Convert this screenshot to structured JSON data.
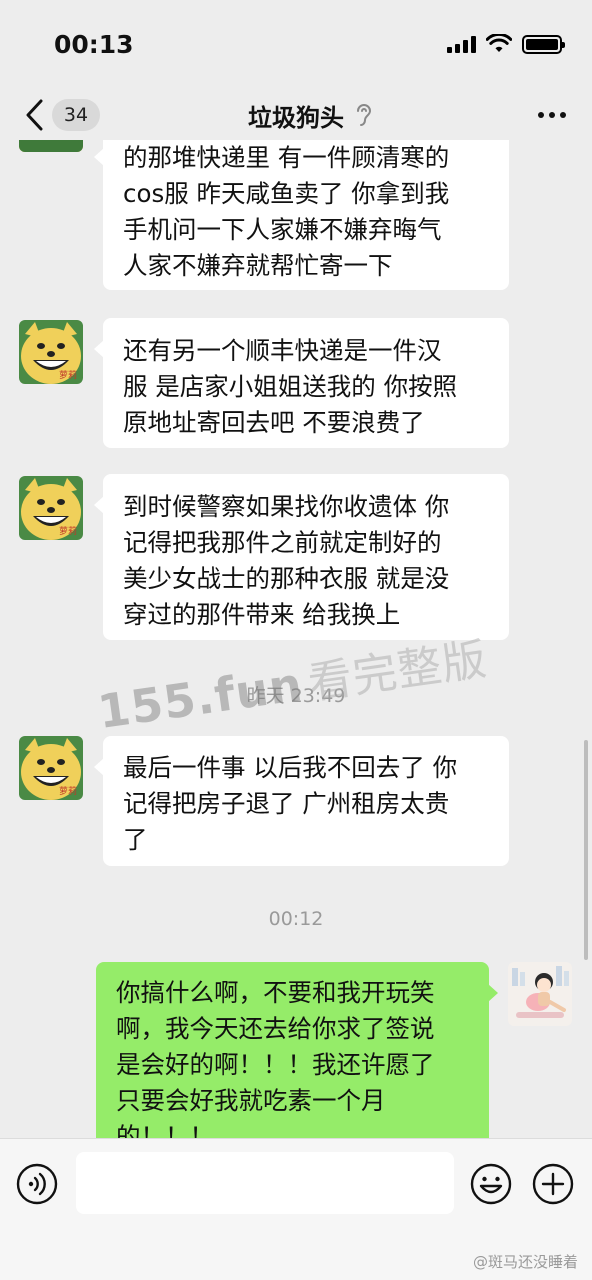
{
  "status_bar": {
    "time": "00:13"
  },
  "nav": {
    "unread_count": "34",
    "title": "垃圾狗头"
  },
  "chat": {
    "messages": [
      {
        "lines": [
          "的那堆快递里 有一件顾清寒的",
          "cos服 昨天咸鱼卖了 你拿到我",
          "手机问一下人家嫌不嫌弃晦气",
          "人家不嫌弃就帮忙寄一下"
        ]
      },
      {
        "lines": [
          "还有另一个顺丰快递是一件汉",
          "服 是店家小姐姐送我的 你按照",
          "原地址寄回去吧 不要浪费了"
        ]
      },
      {
        "lines": [
          "到时候警察如果找你收遗体 你",
          "记得把我那件之前就定制好的",
          "美少女战士的那种衣服 就是没",
          "穿过的那件带来 给我换上"
        ]
      },
      {
        "lines": [
          "最后一件事 以后我不回去了 你",
          "记得把房子退了 广州租房太贵",
          "了"
        ]
      },
      {
        "lines": [
          "你搞什么啊，不要和我开玩笑",
          "啊，我今天还去给你求了签说",
          "是会好的啊！！！我还许愿了",
          "只要会好我就吃素一个月",
          "的！！！"
        ]
      }
    ],
    "timestamps": [
      "昨天 23:49",
      "00:12"
    ],
    "avatar_text": "萝莉"
  },
  "watermark": {
    "site": "155.fun",
    "text": "看完整版"
  },
  "input_bar": {
    "placeholder": ""
  },
  "source_mark": "@斑马还没睡着",
  "colors": {
    "background": "#ededed",
    "outgoing_bubble": "#95ec69",
    "incoming_bubble": "#ffffff",
    "input_bar": "#f6f6f6"
  }
}
